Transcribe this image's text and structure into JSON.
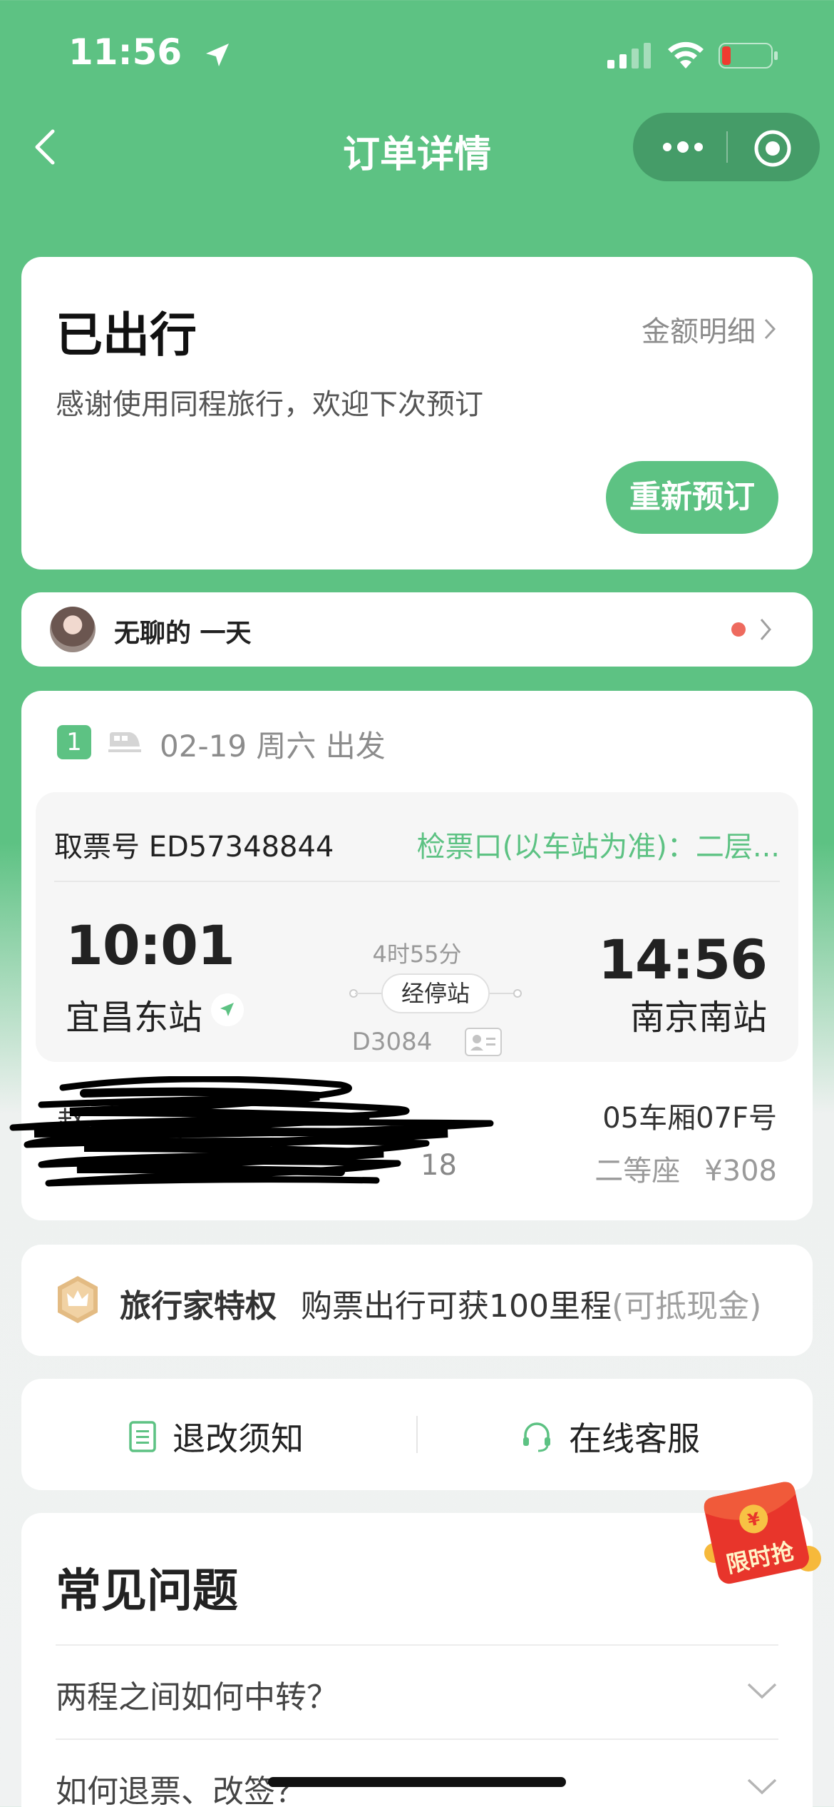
{
  "status_bar": {
    "time": "11:56"
  },
  "nav": {
    "title": "订单详情"
  },
  "order_status": {
    "title": "已出行",
    "amount_detail": "金额明细",
    "subtitle": "感谢使用同程旅行，欢迎下次预订",
    "rebook_label": "重新预订"
  },
  "user": {
    "name": "无聊的 一天"
  },
  "trip": {
    "index": "1",
    "date": "02-19 周六 出发",
    "pickup_no": "取票号 ED57348844",
    "gate": "检票口(以车站为准)：二层...",
    "departure": {
      "time": "10:01",
      "station": "宜昌东站"
    },
    "arrival": {
      "time": "14:56",
      "station": "南京南站"
    },
    "duration": "4时55分",
    "stops_label": "经停站",
    "train_no": "D3084",
    "passenger_name": "赵",
    "passenger_id": "18",
    "seat": "05车厢07F号",
    "seat_class": "二等座",
    "price": "¥308"
  },
  "privilege": {
    "title": "旅行家特权",
    "desc": "购票出行可获100里程",
    "desc_note": "(可抵现金)"
  },
  "actions": {
    "refund_rules": "退改须知",
    "online_service": "在线客服"
  },
  "faq": {
    "title": "常见问题",
    "items": [
      "两程之间如何中转？",
      "如何退票、改签？"
    ]
  },
  "promo": {
    "label": "限时抢"
  },
  "colors": {
    "brand_green": "#5dc283",
    "alert_red": "#ee6a5e"
  }
}
